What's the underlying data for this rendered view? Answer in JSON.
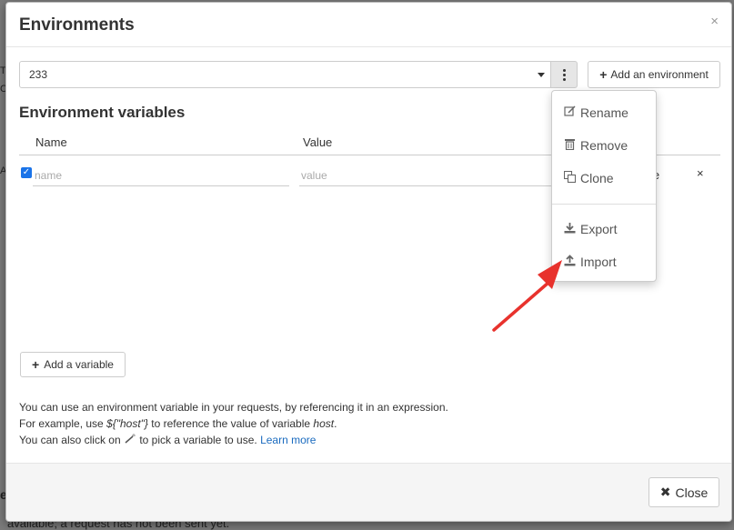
{
  "modal": {
    "title": "Environments",
    "close_symbol": "×"
  },
  "environment_select": {
    "value": "233"
  },
  "add_environment_button": {
    "label": "Add an environment"
  },
  "variables": {
    "section_title": "Environment variables",
    "columns": [
      "Name",
      "Value"
    ],
    "rows": [
      {
        "name_placeholder": "name",
        "value_placeholder": "value",
        "hidden_label_fragment": "ute",
        "remove_symbol": "×"
      }
    ],
    "add_button_label": "Add a variable"
  },
  "help": {
    "line1": "You can use an environment variable in your requests, by referencing it in an expression.",
    "line2_prefix": "For example, use ",
    "line2_code": "${\"host\"}",
    "line2_middle": " to reference the value of variable ",
    "line2_var": "host",
    "line2_suffix": ".",
    "line3_prefix": "You can also click on ",
    "line3_middle": " to pick a variable to use. ",
    "line3_link": "Learn more"
  },
  "footer": {
    "close_label": "Close"
  },
  "dropdown_menu": {
    "items": [
      {
        "label": "Rename",
        "icon": "edit-icon"
      },
      {
        "label": "Remove",
        "icon": "trash-icon"
      },
      {
        "label": "Clone",
        "icon": "clone-icon"
      },
      {
        "label": "Export",
        "icon": "download-icon"
      },
      {
        "label": "Import",
        "icon": "upload-icon"
      }
    ]
  },
  "background_fragments": {
    "f1": "T",
    "f2": "C",
    "f3": "A",
    "f4": "e",
    "bottom_text": "available; a request has not been sent yet."
  },
  "colors": {
    "accent": "#1a73e8",
    "link": "#1a6bbf",
    "annotation_arrow": "#e8322d"
  }
}
